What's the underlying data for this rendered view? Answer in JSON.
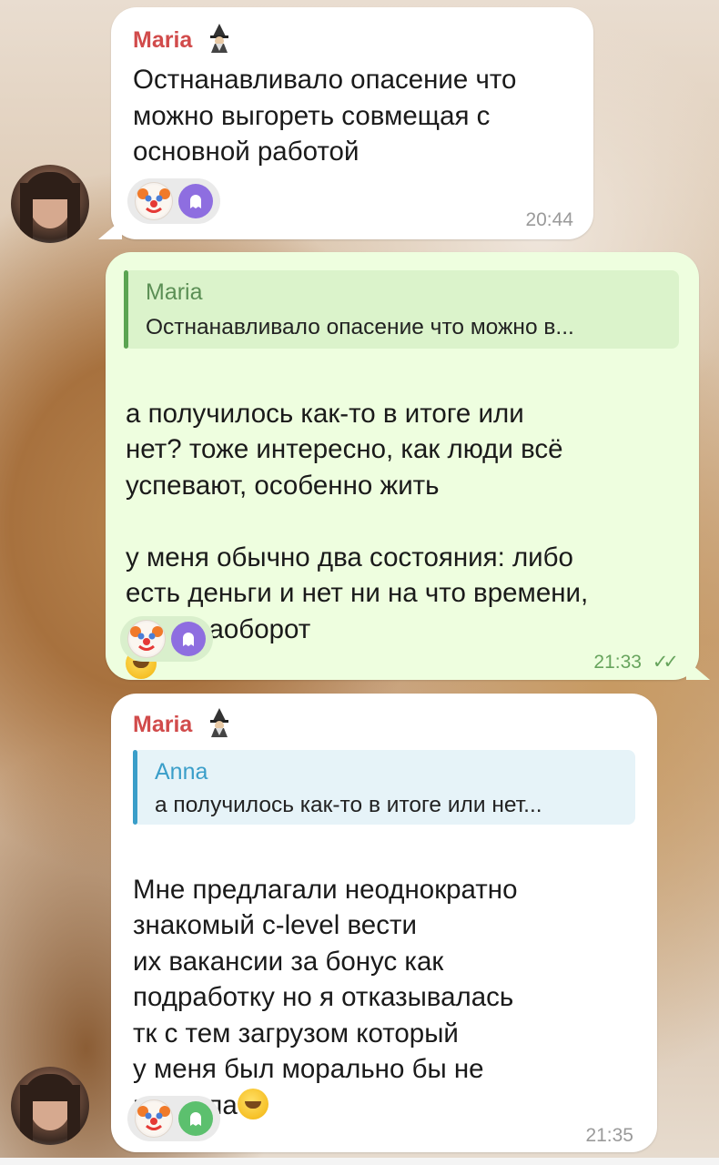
{
  "messages": [
    {
      "sender": "Maria",
      "text": "Остнанавливало опасение что\nможно выгореть совмещая с\nосновной работой",
      "time": "20:44",
      "reactions": [
        "clown",
        "ghost"
      ]
    },
    {
      "reply_name": "Maria",
      "reply_text": "Остнанавливало опасение что можно в...",
      "text": "а получилось как-то в итоге или\nнет? тоже интересно, как люди всё\nуспевают, особенно жить\n\nу меня обычно два состояния: либо\nесть деньги и нет ни на что времени,\nлибо наоборот",
      "time": "21:33",
      "status": "✓✓",
      "reactions": [
        "clown",
        "ghost"
      ]
    },
    {
      "sender": "Maria",
      "reply_name": "Anna",
      "reply_text": "а получилось как-то в итоге или нет...",
      "text": "Мне предлагали неоднократно\nзнакомый c-level вести\nих вакансии за бонус как\nподработку но я отказывалась\nтк с тем загрузом который\nу меня был морально бы не\nвывезла",
      "time": "21:35",
      "reactions": [
        "clown",
        "ghost"
      ]
    }
  ],
  "colors": {
    "sender": "#d14b4b",
    "reply_anna": "#3a9ec9",
    "reply_outgoing": "#5ba452",
    "ghost_purple": "#8e6ee0",
    "ghost_green": "#5cc06e",
    "outgoing_bg": "#eefedf",
    "incoming_bg": "#ffffff"
  },
  "icons": {
    "sender_badge": "wizard-icon",
    "laugh": "tears-of-joy-emoji",
    "woozy": "woozy-face-emoji",
    "read_receipt": "double-check-icon"
  }
}
